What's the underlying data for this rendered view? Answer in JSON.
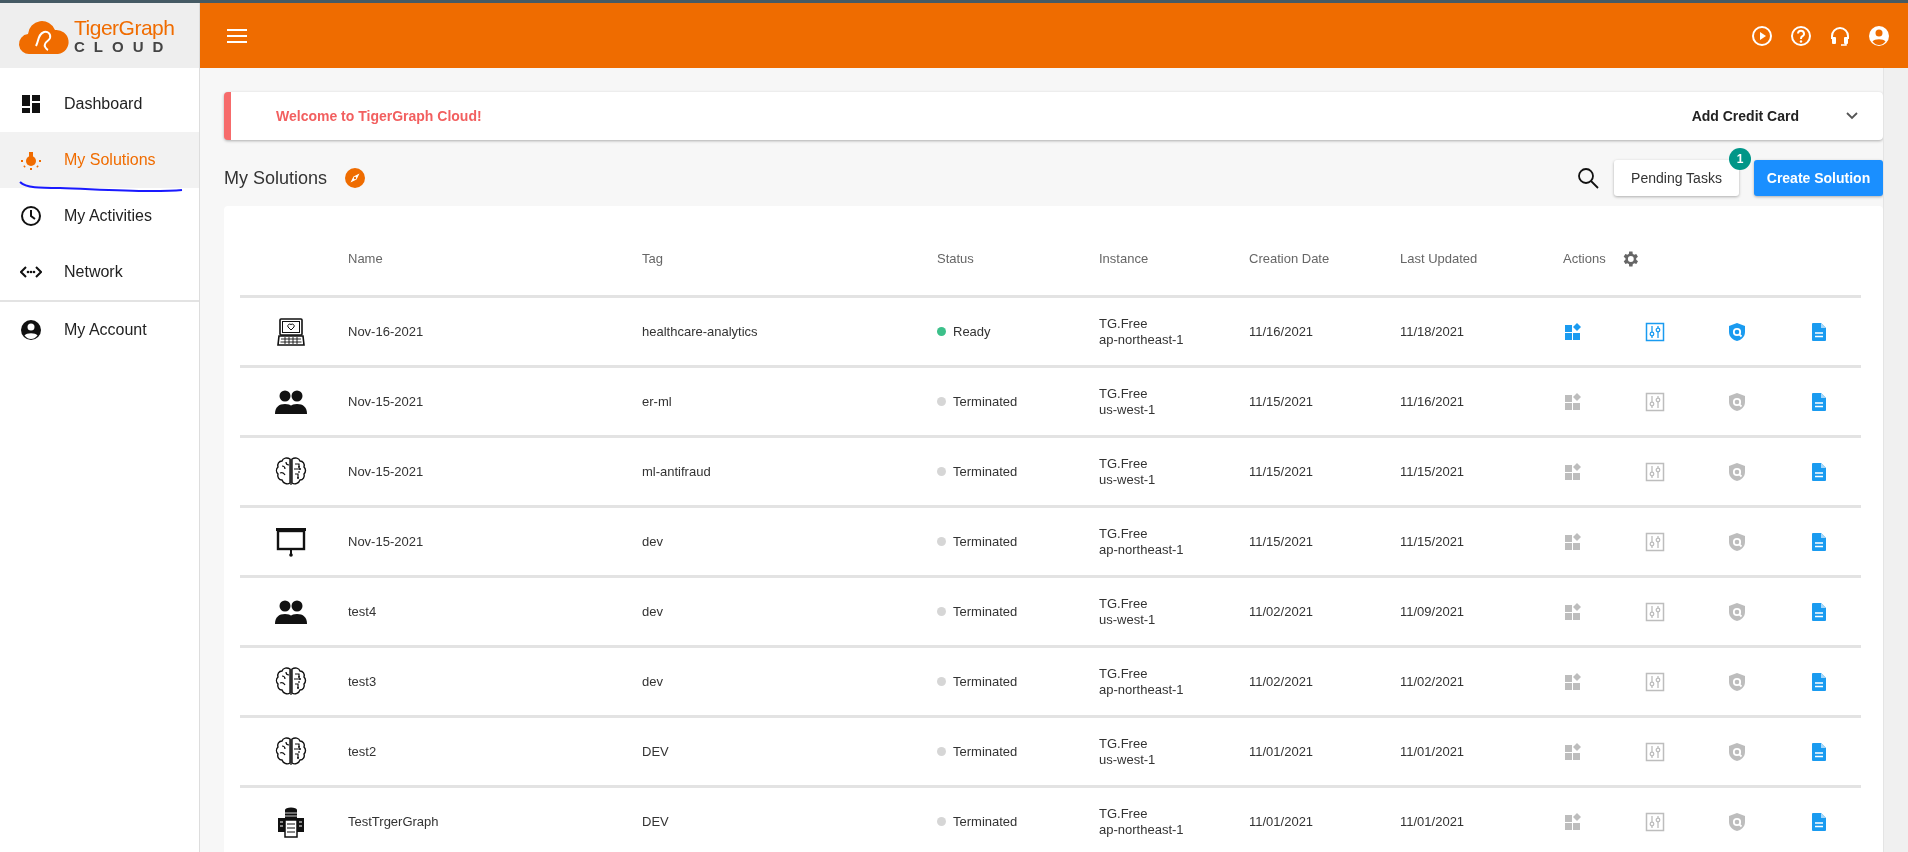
{
  "app": {
    "logo_name": "TigerGraph",
    "logo_sub": "CLOUD"
  },
  "sidebar": {
    "items": [
      {
        "label": "Dashboard",
        "kind": "dashboard",
        "selected": false
      },
      {
        "label": "My Solutions",
        "kind": "bulb",
        "selected": true
      },
      {
        "label": "My Activities",
        "kind": "clock",
        "selected": false
      },
      {
        "label": "Network",
        "kind": "network",
        "selected": false
      },
      {
        "label": "My Account",
        "kind": "account",
        "selected": false
      }
    ]
  },
  "banner": {
    "message": "Welcome to TigerGraph Cloud!",
    "action": "Add Credit Card"
  },
  "page_title": "My Solutions",
  "toolbar": {
    "pending_label": "Pending Tasks",
    "pending_count": "1",
    "create_label": "Create Solution"
  },
  "table": {
    "columns": [
      "Name",
      "Tag",
      "Status",
      "Instance",
      "Creation Date",
      "Last Updated",
      "Actions"
    ],
    "rows": [
      {
        "kind": "laptop",
        "name": "Nov-16-2021",
        "tag": "healthcare-analytics",
        "status": "Ready",
        "color": "#3cc08a",
        "instance": [
          "TG.Free",
          "ap-northeast-1"
        ],
        "created": "11/16/2021",
        "updated": "11/18/2021",
        "actions_enabled": true
      },
      {
        "kind": "people",
        "name": "Nov-15-2021",
        "tag": "er-ml",
        "status": "Terminated",
        "color": "#d6d6d6",
        "instance": [
          "TG.Free",
          "us-west-1"
        ],
        "created": "11/15/2021",
        "updated": "11/16/2021",
        "actions_enabled": false
      },
      {
        "kind": "brain",
        "name": "Nov-15-2021",
        "tag": "ml-antifraud",
        "status": "Terminated",
        "color": "#d6d6d6",
        "instance": [
          "TG.Free",
          "us-west-1"
        ],
        "created": "11/15/2021",
        "updated": "11/15/2021",
        "actions_enabled": false
      },
      {
        "kind": "presentation",
        "name": "Nov-15-2021",
        "tag": "dev",
        "status": "Terminated",
        "color": "#d6d6d6",
        "instance": [
          "TG.Free",
          "ap-northeast-1"
        ],
        "created": "11/15/2021",
        "updated": "11/15/2021",
        "actions_enabled": false
      },
      {
        "kind": "people",
        "name": "test4",
        "tag": "dev",
        "status": "Terminated",
        "color": "#d6d6d6",
        "instance": [
          "TG.Free",
          "us-west-1"
        ],
        "created": "11/02/2021",
        "updated": "11/09/2021",
        "actions_enabled": false
      },
      {
        "kind": "brain",
        "name": "test3",
        "tag": "dev",
        "status": "Terminated",
        "color": "#d6d6d6",
        "instance": [
          "TG.Free",
          "ap-northeast-1"
        ],
        "created": "11/02/2021",
        "updated": "11/02/2021",
        "actions_enabled": false
      },
      {
        "kind": "brain",
        "name": "test2",
        "tag": "DEV",
        "status": "Terminated",
        "color": "#d6d6d6",
        "instance": [
          "TG.Free",
          "us-west-1"
        ],
        "created": "11/01/2021",
        "updated": "11/01/2021",
        "actions_enabled": false
      },
      {
        "kind": "database",
        "name": "TestTrgerGraph",
        "tag": "DEV",
        "status": "Terminated",
        "color": "#d6d6d6",
        "instance": [
          "TG.Free",
          "ap-northeast-1"
        ],
        "created": "11/01/2021",
        "updated": "11/01/2021",
        "actions_enabled": false
      }
    ]
  }
}
